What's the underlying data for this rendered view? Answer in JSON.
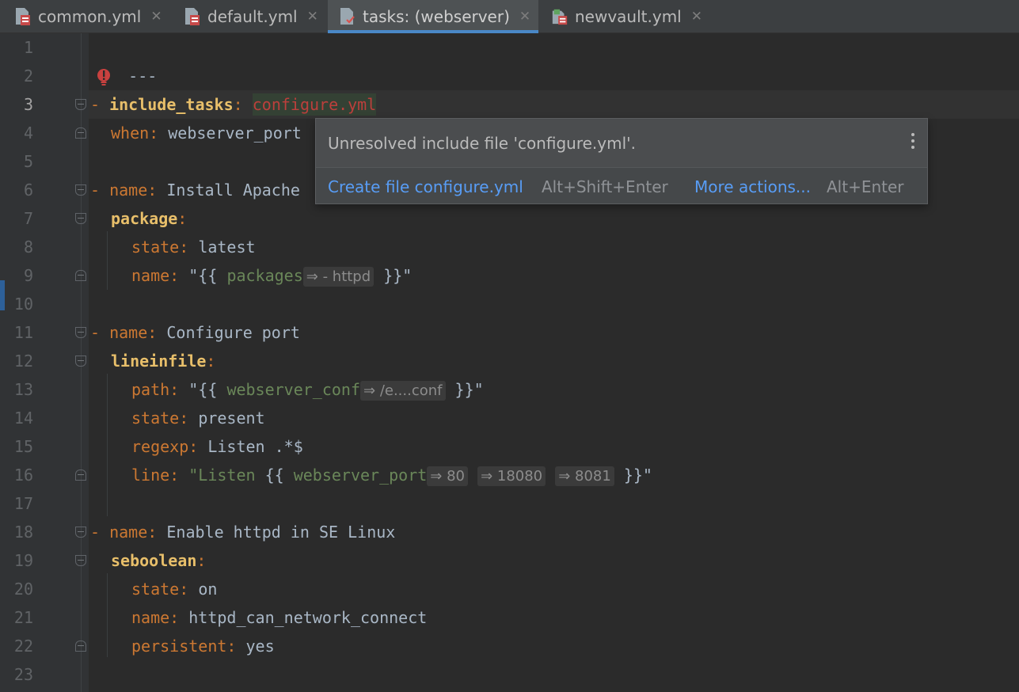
{
  "tabs": [
    {
      "label": "common.yml",
      "active": false,
      "icon": "yaml-file-icon"
    },
    {
      "label": "default.yml",
      "active": false,
      "icon": "yaml-file-icon"
    },
    {
      "label": "tasks: (webserver)",
      "active": true,
      "icon": "tasks-file-icon"
    },
    {
      "label": "newvault.yml",
      "active": false,
      "icon": "vault-file-icon"
    }
  ],
  "tab_close_glyph": "✕",
  "line_numbers": [
    "1",
    "2",
    "3",
    "4",
    "5",
    "6",
    "7",
    "8",
    "9",
    "10",
    "11",
    "12",
    "13",
    "14",
    "15",
    "16",
    "17",
    "18",
    "19",
    "20",
    "21",
    "22",
    "23"
  ],
  "current_line": "3",
  "code": {
    "l1": "---",
    "l3_dash": "- ",
    "l3_key": "include_tasks",
    "l3_colon": ": ",
    "l3_val": "configure.yml",
    "l4_key": "when",
    "l4_colon": ": ",
    "l4_val": "webserver_port",
    "l6_dash": "- ",
    "l6_key": "name",
    "l6_colon": ": ",
    "l6_val": "Install Apache",
    "l7_key": "package",
    "l7_colon": ":",
    "l8_key": "state",
    "l8_colon": ": ",
    "l8_val": "latest",
    "l9_key": "name",
    "l9_colon": ": ",
    "l9_open": "\"{{ ",
    "l9_var": "packages",
    "l9_hint": "⇒ - httpd",
    "l9_close": " }}\"",
    "l11_dash": "- ",
    "l11_key": "name",
    "l11_colon": ": ",
    "l11_val": "Configure port",
    "l12_key": "lineinfile",
    "l12_colon": ":",
    "l13_key": "path",
    "l13_colon": ": ",
    "l13_open": "\"{{ ",
    "l13_var": "webserver_conf",
    "l13_hint": "⇒ /e....conf",
    "l13_close": " }}\"",
    "l14_key": "state",
    "l14_colon": ": ",
    "l14_val": "present",
    "l15_key": "regexp",
    "l15_colon": ": ",
    "l15_val": "Listen .*$",
    "l16_key": "line",
    "l16_colon": ": ",
    "l16_open": "\"Listen ",
    "l16_brace": "{{ ",
    "l16_var": "webserver_port",
    "l16_hint1": "⇒ 80",
    "l16_hint2": "⇒ 18080",
    "l16_hint3": "⇒ 8081",
    "l16_close": " }}\"",
    "l18_dash": "- ",
    "l18_key": "name",
    "l18_colon": ": ",
    "l18_val": "Enable httpd in SE Linux",
    "l19_key": "seboolean",
    "l19_colon": ":",
    "l20_key": "state",
    "l20_colon": ": ",
    "l20_val": "on",
    "l21_key": "name",
    "l21_colon": ": ",
    "l21_val": "httpd_can_network_connect",
    "l22_key": "persistent",
    "l22_colon": ": ",
    "l22_val": "yes"
  },
  "popup": {
    "message": "Unresolved include file 'configure.yml'.",
    "action1_label": "Create file configure.yml",
    "action1_shortcut": "Alt+Shift+Enter",
    "action2_label": "More actions...",
    "action2_shortcut": "Alt+Enter"
  },
  "colors": {
    "background": "#2b2b2b",
    "keyword": "#cc7832",
    "key_bold": "#e8bf6a",
    "string": "#6a8759",
    "error": "#bc3f3c",
    "link": "#589df6",
    "active_tab_underline": "#4a88c7"
  }
}
